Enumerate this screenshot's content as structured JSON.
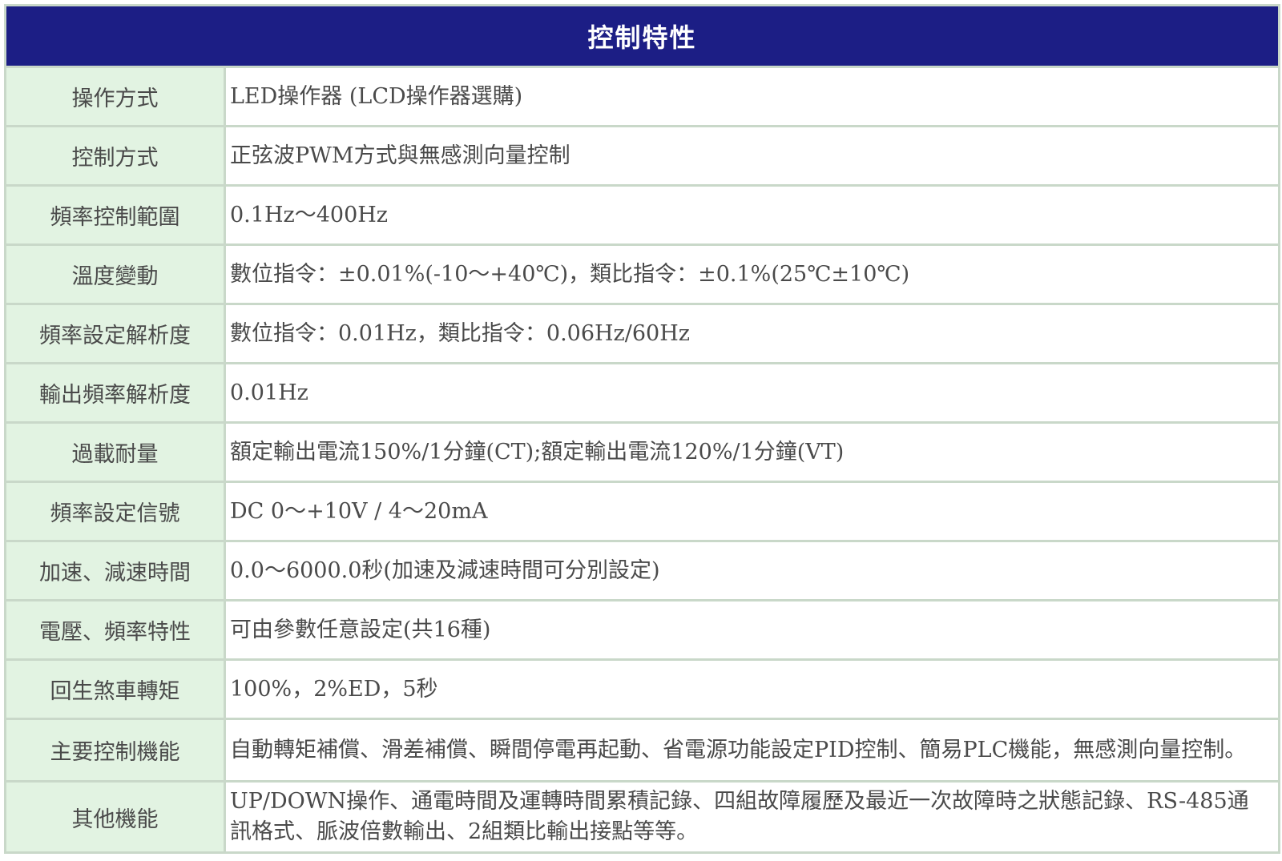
{
  "title": "控制特性",
  "rows": [
    {
      "label": "操作方式",
      "value": "LED操作器 (LCD操作器選購)"
    },
    {
      "label": "控制方式",
      "value": "正弦波PWM方式與無感測向量控制"
    },
    {
      "label": "頻率控制範圍",
      "value": "0.1Hz～400Hz"
    },
    {
      "label": "溫度變動",
      "value": "數位指令：±0.01%(-10～+40℃)，類比指令：±0.1%(25℃±10℃)"
    },
    {
      "label": "頻率設定解析度",
      "value": "數位指令：0.01Hz，類比指令：0.06Hz/60Hz"
    },
    {
      "label": "輸出頻率解析度",
      "value": "0.01Hz"
    },
    {
      "label": "過載耐量",
      "value": "額定輸出電流150%/1分鐘(CT);額定輸出電流120%/1分鐘(VT)"
    },
    {
      "label": "頻率設定信號",
      "value": "DC 0～+10V / 4～20mA"
    },
    {
      "label": "加速、減速時間",
      "value": "0.0～6000.0秒(加速及減速時間可分別設定)"
    },
    {
      "label": "電壓、頻率特性",
      "value": "可由參數任意設定(共16種)"
    },
    {
      "label": "回生煞車轉矩",
      "value": "100%，2%ED，5秒"
    },
    {
      "label": "主要控制機能",
      "value": "自動轉矩補償、滑差補償、瞬間停電再起動、省電源功能設定PID控制、簡易PLC機能，無感測向量控制。"
    },
    {
      "label": "其他機能",
      "value": "UP/DOWN操作、通電時間及運轉時間累積記錄、四組故障履歷及最近一次故障時之狀態記錄、RS-485通訊格式、脈波倍數輸出、2組類比輸出接點等等。"
    }
  ]
}
